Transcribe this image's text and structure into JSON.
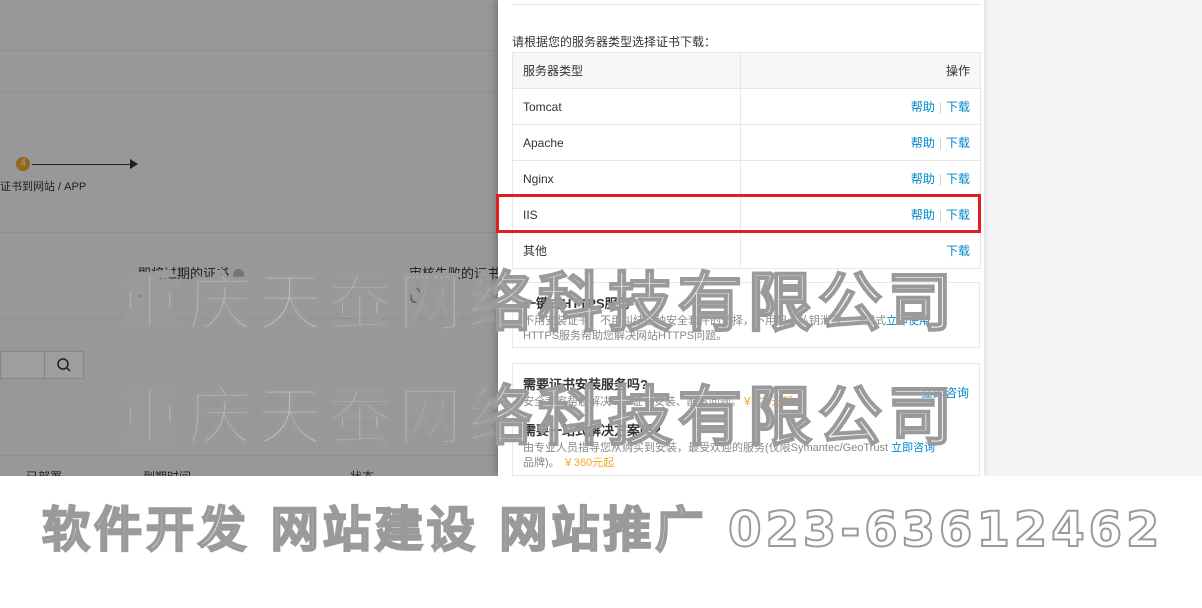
{
  "background": {
    "step": {
      "number": "4",
      "label": "证书到网站 / APP"
    },
    "stats": [
      {
        "label": "即将过期的证书",
        "value": "0"
      },
      {
        "label": "审核失败的证书",
        "value": "0"
      }
    ],
    "table_headers": [
      "已部署",
      "到期时间",
      "状态"
    ]
  },
  "drawer": {
    "intro": "请根据您的服务器类型选择证书下载：",
    "table": {
      "headers": {
        "server_type": "服务器类型",
        "action": "操作"
      },
      "rows": [
        {
          "name": "Tomcat",
          "help": "帮助",
          "download": "下载"
        },
        {
          "name": "Apache",
          "help": "帮助",
          "download": "下载"
        },
        {
          "name": "Nginx",
          "help": "帮助",
          "download": "下载"
        },
        {
          "name": "IIS",
          "help": "帮助",
          "download": "下载"
        },
        {
          "name": "其他",
          "download": "下载"
        }
      ],
      "highlighted_row": "IIS"
    },
    "one_click": {
      "title": "一键式HTTPS服务",
      "desc": "不用安装证书，不用纠结各种安全套件的选择，不用担心私钥泄露，一键式",
      "link": "立即使用",
      "desc2": "HTTPS服务帮助您解决网站HTTPS问题。"
    },
    "install": {
      "title": "需要证书安装服务吗?",
      "desc": "安全专家帮您解决SSL证书安装、配置问题。",
      "price": "￥120元起",
      "link": "立即咨询"
    },
    "solution": {
      "title": "需要一站式解决方案吗?",
      "desc": "由专业人员指导您从购买到安装，最受欢迎的服务(仅限Symantec/GeoTrust",
      "link": "立即咨询",
      "desc2": "品牌)。",
      "price": "￥360元起"
    }
  },
  "watermark": {
    "line1": "重庆天蚕网络科技有限公司",
    "line2": "重庆天蚕网络科技有限公司",
    "line3": "软件开发 网站建设 网站推广 023-63612462"
  },
  "colors": {
    "highlight": "#e02020",
    "link": "#0088cc",
    "price": "#f5a623"
  }
}
